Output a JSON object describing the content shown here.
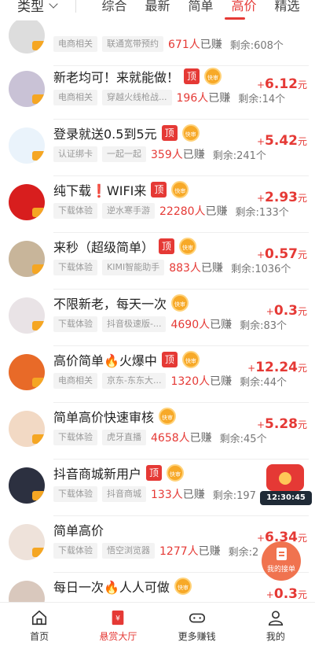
{
  "filter": {
    "type_label": "类型",
    "tabs": [
      "综合",
      "最新",
      "简单",
      "高价",
      "精选"
    ],
    "active_tab": "高价"
  },
  "colors": {
    "accent": "#e53935",
    "tag_bg": "#f3f3f3",
    "kuai_badge": "#f7a928"
  },
  "items": [
    {
      "title": "",
      "ding": false,
      "kuai": false,
      "tags": [
        "电商相关",
        "联通宽带预约"
      ],
      "earned": "671人",
      "earned_unit": "已赚",
      "remain": "剩余:608个",
      "price": "",
      "avatar": "generic"
    },
    {
      "title": "新老均可！来就能做！",
      "ding": true,
      "kuai": true,
      "tags": [
        "电商相关",
        "穿越火线枪战..."
      ],
      "earned": "196人",
      "earned_unit": "已赚",
      "remain": "剩余:14个",
      "price": "6.12",
      "avatar": "girl"
    },
    {
      "title": "登录就送0.5到5元",
      "ding": true,
      "kuai": true,
      "tags": [
        "认证绑卡",
        "一起一起"
      ],
      "earned": "359人",
      "earned_unit": "已赚",
      "remain": "剩余:241个",
      "price": "5.42",
      "avatar": "logo"
    },
    {
      "title": "纯下载❗WIFI来",
      "ding": true,
      "kuai": true,
      "tags": [
        "下载体验",
        "逆水寒手游"
      ],
      "earned": "22280人",
      "earned_unit": "已赚",
      "remain": "剩余:133个",
      "price": "2.93",
      "avatar": "miao"
    },
    {
      "title": "来秒（超级简单）",
      "ding": true,
      "kuai": true,
      "tags": [
        "下载体验",
        "KIMI智能助手"
      ],
      "earned": "883人",
      "earned_unit": "已赚",
      "remain": "剩余:1036个",
      "price": "0.57",
      "avatar": "dog"
    },
    {
      "title": "不限新老，每天一次",
      "ding": false,
      "kuai": true,
      "tags": [
        "下载体验",
        "抖音极速版-..."
      ],
      "earned": "4690人",
      "earned_unit": "已赚",
      "remain": "剩余:83个",
      "price": "0.3",
      "avatar": "girl2"
    },
    {
      "title": "高价简单🔥火爆中",
      "ding": true,
      "kuai": true,
      "tags": [
        "电商相关",
        "京东-东东大..."
      ],
      "earned": "1320人",
      "earned_unit": "已赚",
      "remain": "剩余:44个",
      "price": "12.24",
      "avatar": "jiandan"
    },
    {
      "title": "简单高价快速审核",
      "ding": false,
      "kuai": true,
      "tags": [
        "下载体验",
        "虎牙直播"
      ],
      "earned": "4658人",
      "earned_unit": "已赚",
      "remain": "剩余:45个",
      "price": "5.28",
      "avatar": "boy"
    },
    {
      "title": "抖音商城新用户",
      "ding": true,
      "kuai": true,
      "tags": [
        "下载体验",
        "抖音商城"
      ],
      "earned": "133人",
      "earned_unit": "已赚",
      "remain": "剩余:197",
      "price": "",
      "avatar": "flower"
    },
    {
      "title": "简单高价",
      "ding": false,
      "kuai": false,
      "tags": [
        "下载体验",
        "悟空浏览器"
      ],
      "earned": "1277人",
      "earned_unit": "已赚",
      "remain": "剩余:2",
      "price": "6.34",
      "avatar": "girl3"
    },
    {
      "title": "每日一次🔥人人可做",
      "ding": false,
      "kuai": true,
      "tags": [],
      "earned": "",
      "earned_unit": "",
      "remain": "",
      "price": "0.3",
      "avatar": "boy2"
    }
  ],
  "price_prefix": "+",
  "price_unit": "元",
  "badges": {
    "ding": "顶",
    "kuai": "快审"
  },
  "redpack_timer": "12:30:45",
  "my_order_label": "我的接单",
  "bottom_nav": [
    {
      "label": "首页",
      "icon": "home-icon"
    },
    {
      "label": "悬赏大厅",
      "icon": "bounty-icon",
      "active": true
    },
    {
      "label": "更多赚钱",
      "icon": "gamepad-icon"
    },
    {
      "label": "我的",
      "icon": "user-icon"
    }
  ]
}
